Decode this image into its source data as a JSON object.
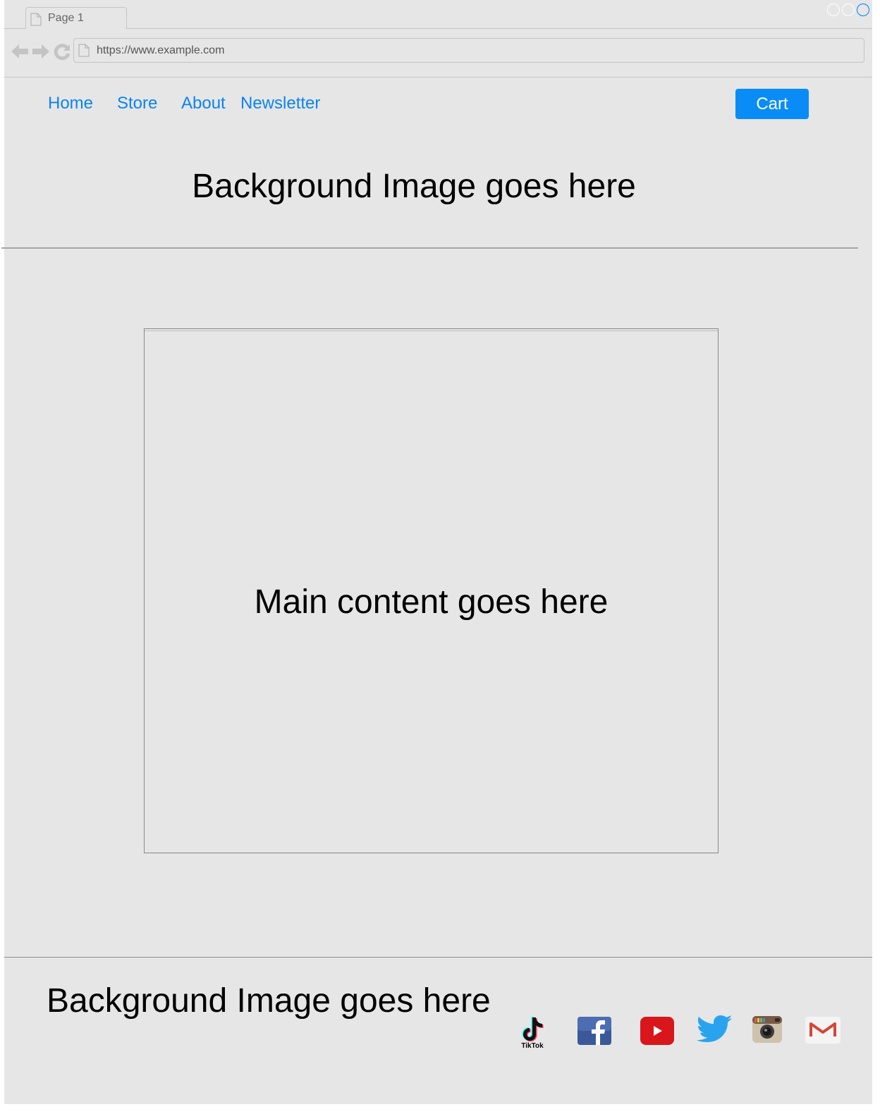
{
  "browser": {
    "tab_label": "Page 1",
    "url": "https://www.example.com",
    "icons": [
      "back-icon",
      "forward-icon",
      "refresh-icon",
      "page-icon"
    ],
    "window_controls": [
      "minimize",
      "maximize",
      "close"
    ],
    "accent_color": "#0a84f0"
  },
  "nav": {
    "items": [
      "Home",
      "Store",
      "About",
      "Newsletter"
    ],
    "cart_label": "Cart"
  },
  "hero": {
    "text": "Background Image goes here"
  },
  "main": {
    "text": "Main content goes here"
  },
  "footer": {
    "text": "Background Image goes here",
    "social": [
      "tiktok-icon",
      "facebook-icon",
      "youtube-icon",
      "twitter-icon",
      "instagram-icon",
      "gmail-icon"
    ],
    "tiktok_label": "TikTok"
  }
}
